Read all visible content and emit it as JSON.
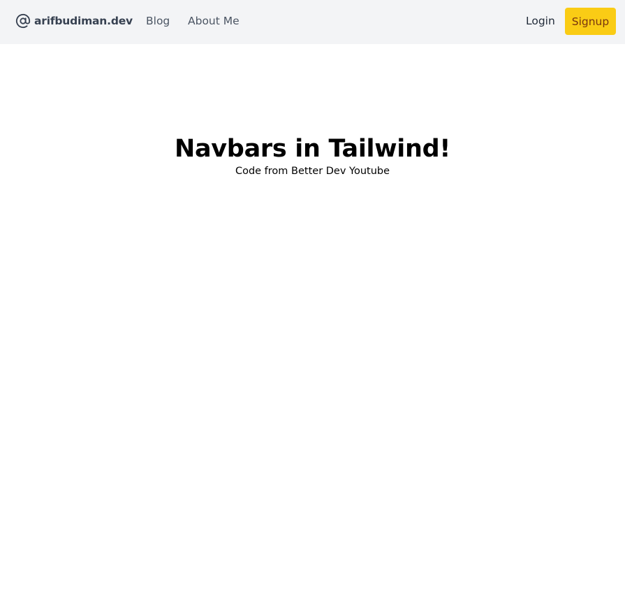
{
  "navbar": {
    "brand": {
      "icon": "at-sign-icon",
      "label": "arifbudiman.dev"
    },
    "links": [
      {
        "label": "Blog"
      },
      {
        "label": "About Me"
      }
    ],
    "login_label": "Login",
    "signup_label": "Signup"
  },
  "hero": {
    "title": "Navbars in Tailwind!",
    "subtitle": "Code from Better Dev Youtube"
  },
  "colors": {
    "navbar_bg": "#f3f4f6",
    "signup_bg": "#facc15",
    "signup_text": "#78350f",
    "nav_text": "#4b5563"
  }
}
